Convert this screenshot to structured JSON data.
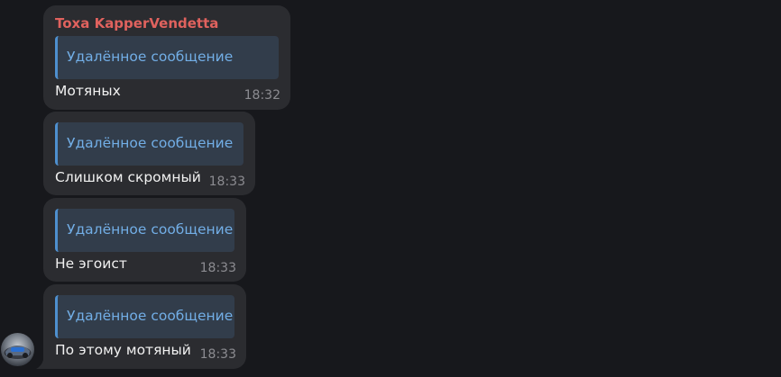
{
  "chat": {
    "sender_name": "Toxa KapperVendetta",
    "colors": {
      "sender": "#e0625e",
      "reply_accent": "#4e8fce",
      "reply_text": "#72aee6",
      "bubble": "#2b2c30"
    },
    "messages": [
      {
        "reply_text": "Удалённое сообщение",
        "text": "Мотяных",
        "time": "18:32"
      },
      {
        "reply_text": "Удалённое сообщение",
        "text": "Слишком скромный",
        "time": "18:33"
      },
      {
        "reply_text": "Удалённое сообщение",
        "text": "Не эгоист",
        "time": "18:33"
      },
      {
        "reply_text": "Удалённое сообщение",
        "text": "По этому мотяный",
        "time": "18:33"
      }
    ],
    "avatar_icon": "user-avatar-icon"
  }
}
